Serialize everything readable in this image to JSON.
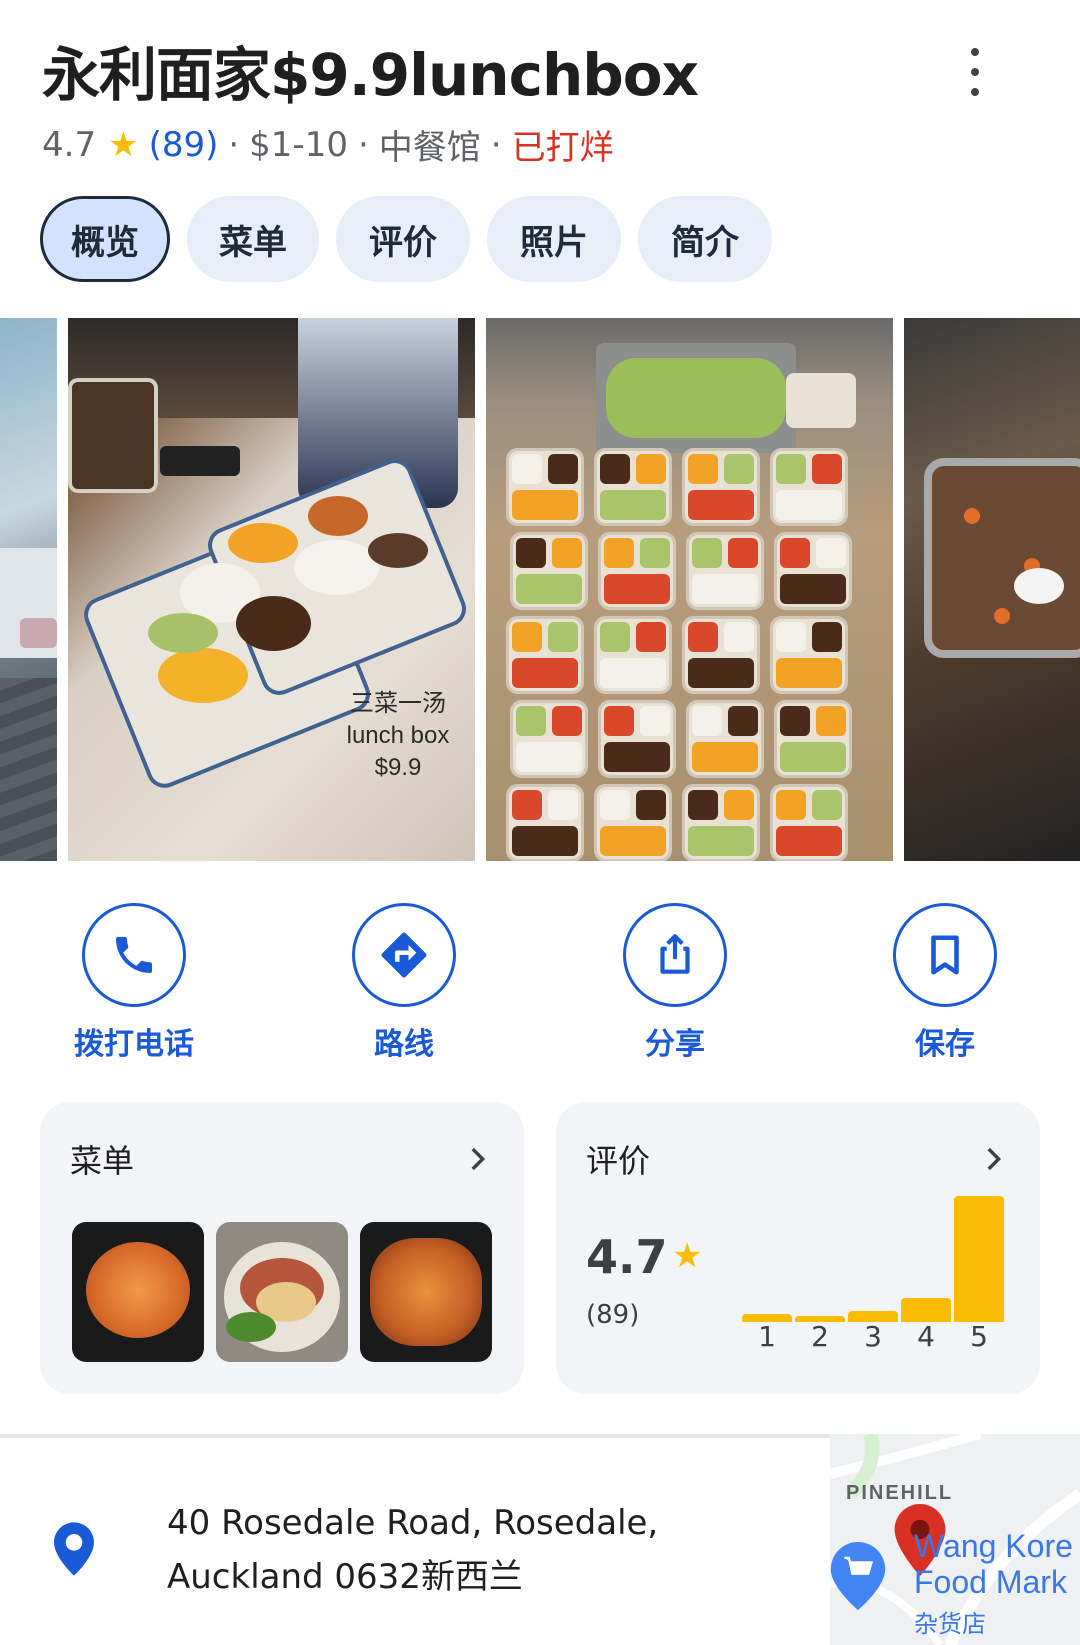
{
  "header": {
    "title": "永利面家$9.9lunchbox",
    "rating": "4.7",
    "review_count": "(89)",
    "price_range": "$1-10",
    "category": "中餐馆",
    "status": "已打烊",
    "separator": "·"
  },
  "tabs": [
    {
      "label": "概览",
      "active": true
    },
    {
      "label": "菜单",
      "active": false
    },
    {
      "label": "评价",
      "active": false
    },
    {
      "label": "照片",
      "active": false
    },
    {
      "label": "简介",
      "active": false
    }
  ],
  "photos": {
    "caption": [
      "三菜一汤",
      "lunch box",
      "$9.9"
    ]
  },
  "actions": [
    {
      "label": "拨打电话",
      "icon": "phone-icon"
    },
    {
      "label": "路线",
      "icon": "directions-icon"
    },
    {
      "label": "分享",
      "icon": "share-icon"
    },
    {
      "label": "保存",
      "icon": "bookmark-icon"
    }
  ],
  "menu_card": {
    "title": "菜单"
  },
  "reviews_card": {
    "title": "评价",
    "rating": "4.7",
    "count": "(89)",
    "distribution": [
      {
        "stars": "1",
        "fraction": 0.06
      },
      {
        "stars": "2",
        "fraction": 0.03
      },
      {
        "stars": "3",
        "fraction": 0.09
      },
      {
        "stars": "4",
        "fraction": 0.19
      },
      {
        "stars": "5",
        "fraction": 1.0
      }
    ]
  },
  "address": {
    "line1": "40 Rosedale Road, Rosedale,",
    "line2": "Auckland 0632新西兰"
  },
  "map": {
    "area_label": "PINEHILL",
    "place_line1": "Wang Kore",
    "place_line2": "Food Mark",
    "place_category": "杂货店"
  },
  "colors": {
    "accent": "#1a5ad7",
    "star": "#fbbc04",
    "closed": "#d93025",
    "chip_bg": "#e8eef8",
    "chip_active_bg": "#d3e3fd"
  }
}
